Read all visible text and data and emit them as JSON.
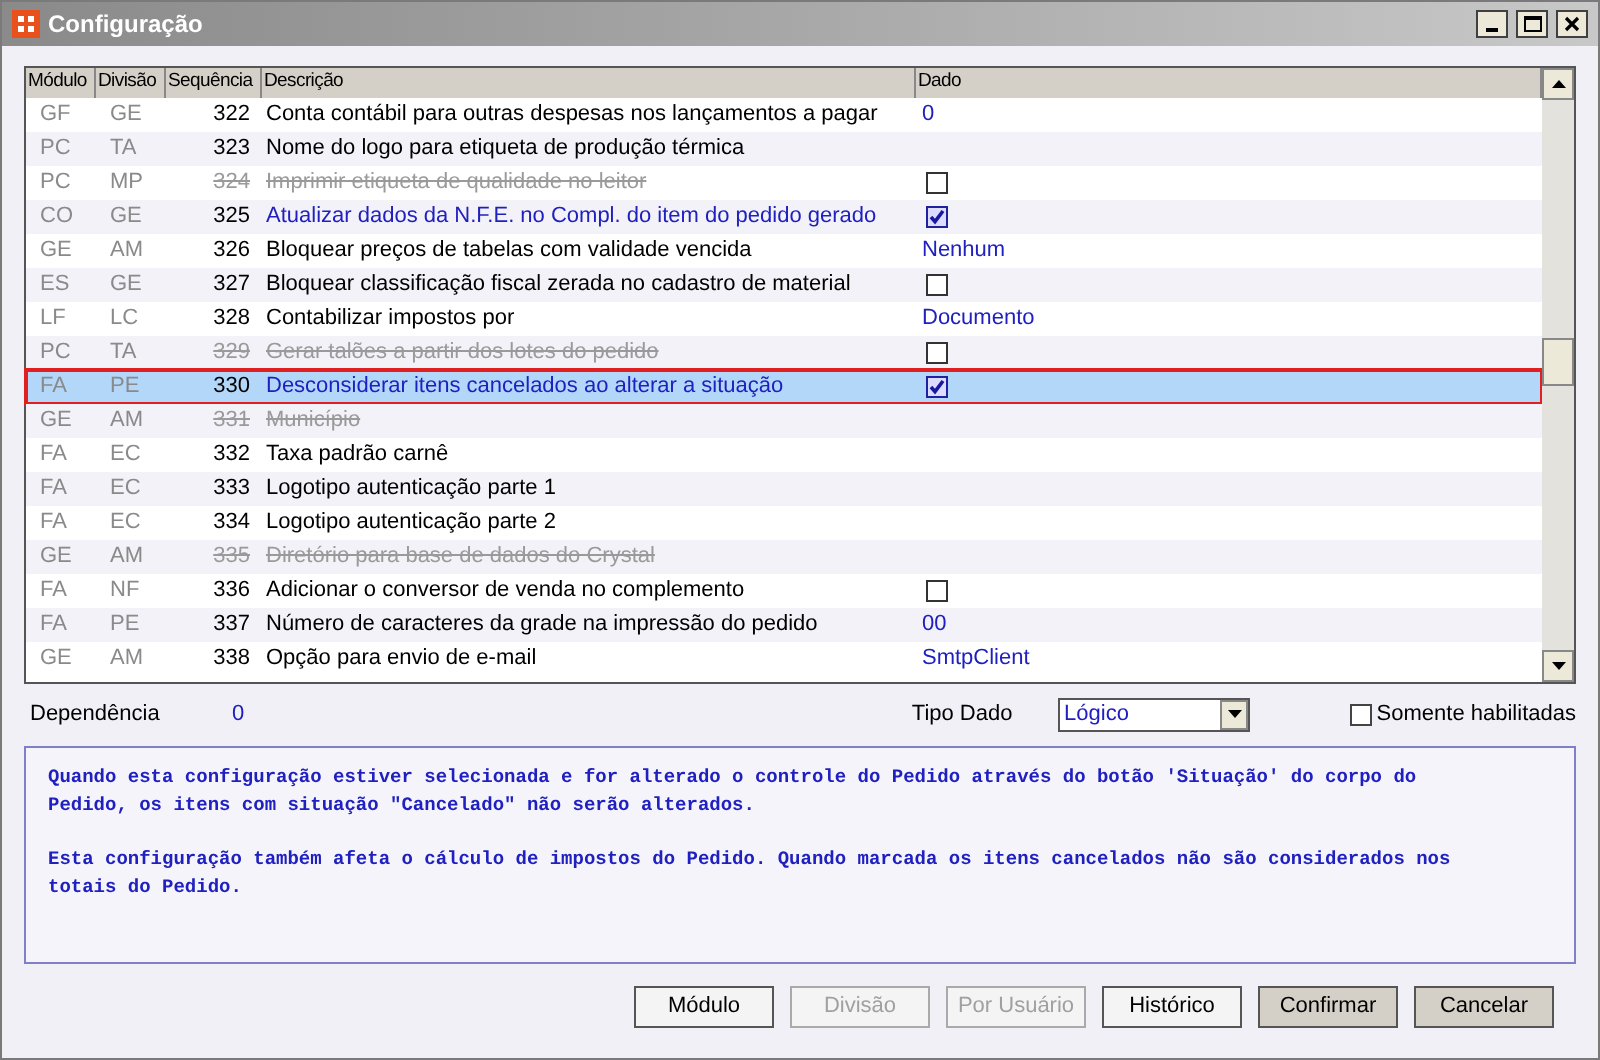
{
  "window": {
    "title": "Configuração"
  },
  "table": {
    "columns": [
      "Módulo",
      "Divisão",
      "Sequência",
      "Descrição",
      "Dado"
    ],
    "rows": [
      {
        "modulo": "GF",
        "divisao": "GE",
        "sequencia": "322",
        "descricao": "Conta contábil para outras despesas nos lançamentos a pagar",
        "disabled": false,
        "highlighted": false,
        "selected": false,
        "dado": {
          "kind": "text",
          "value": "0"
        }
      },
      {
        "modulo": "PC",
        "divisao": "TA",
        "sequencia": "323",
        "descricao": "Nome do logo para etiqueta de produção térmica",
        "disabled": false,
        "highlighted": false,
        "selected": false,
        "dado": {
          "kind": "empty"
        }
      },
      {
        "modulo": "PC",
        "divisao": "MP",
        "sequencia": "324",
        "descricao": "Imprimir etiqueta de qualidade no leitor",
        "disabled": true,
        "highlighted": false,
        "selected": false,
        "dado": {
          "kind": "checkbox",
          "checked": false
        }
      },
      {
        "modulo": "CO",
        "divisao": "GE",
        "sequencia": "325",
        "descricao": "Atualizar dados da N.F.E. no Compl. do item do pedido gerado",
        "disabled": false,
        "highlighted": true,
        "selected": false,
        "dado": {
          "kind": "checkbox",
          "checked": true
        }
      },
      {
        "modulo": "GE",
        "divisao": "AM",
        "sequencia": "326",
        "descricao": "Bloquear preços de tabelas com validade vencida",
        "disabled": false,
        "highlighted": false,
        "selected": false,
        "dado": {
          "kind": "text",
          "value": "Nenhum"
        }
      },
      {
        "modulo": "ES",
        "divisao": "GE",
        "sequencia": "327",
        "descricao": "Bloquear classificação fiscal zerada no cadastro de material",
        "disabled": false,
        "highlighted": false,
        "selected": false,
        "dado": {
          "kind": "checkbox",
          "checked": false
        }
      },
      {
        "modulo": "LF",
        "divisao": "LC",
        "sequencia": "328",
        "descricao": "Contabilizar impostos por",
        "disabled": false,
        "highlighted": false,
        "selected": false,
        "dado": {
          "kind": "text",
          "value": "Documento"
        }
      },
      {
        "modulo": "PC",
        "divisao": "TA",
        "sequencia": "329",
        "descricao": "Gerar talões a partir dos lotes do pedido",
        "disabled": true,
        "highlighted": false,
        "selected": false,
        "dado": {
          "kind": "checkbox",
          "checked": false
        }
      },
      {
        "modulo": "FA",
        "divisao": "PE",
        "sequencia": "330",
        "descricao": "Desconsiderar itens cancelados ao alterar a situação",
        "disabled": false,
        "highlighted": true,
        "selected": true,
        "dado": {
          "kind": "checkbox",
          "checked": true
        }
      },
      {
        "modulo": "GE",
        "divisao": "AM",
        "sequencia": "331",
        "descricao": "Município",
        "disabled": true,
        "highlighted": false,
        "selected": false,
        "dado": {
          "kind": "empty"
        }
      },
      {
        "modulo": "FA",
        "divisao": "EC",
        "sequencia": "332",
        "descricao": "Taxa padrão carnê",
        "disabled": false,
        "highlighted": false,
        "selected": false,
        "dado": {
          "kind": "empty"
        }
      },
      {
        "modulo": "FA",
        "divisao": "EC",
        "sequencia": "333",
        "descricao": "Logotipo autenticação parte 1",
        "disabled": false,
        "highlighted": false,
        "selected": false,
        "dado": {
          "kind": "empty"
        }
      },
      {
        "modulo": "FA",
        "divisao": "EC",
        "sequencia": "334",
        "descricao": "Logotipo autenticação parte 2",
        "disabled": false,
        "highlighted": false,
        "selected": false,
        "dado": {
          "kind": "empty"
        }
      },
      {
        "modulo": "GE",
        "divisao": "AM",
        "sequencia": "335",
        "descricao": "Diretório para base de dados do Crystal",
        "disabled": true,
        "highlighted": false,
        "selected": false,
        "dado": {
          "kind": "empty"
        }
      },
      {
        "modulo": "FA",
        "divisao": "NF",
        "sequencia": "336",
        "descricao": "Adicionar o conversor de venda no complemento",
        "disabled": false,
        "highlighted": false,
        "selected": false,
        "dado": {
          "kind": "checkbox",
          "checked": false
        }
      },
      {
        "modulo": "FA",
        "divisao": "PE",
        "sequencia": "337",
        "descricao": "Número de caracteres da grade na impressão do pedido",
        "disabled": false,
        "highlighted": false,
        "selected": false,
        "dado": {
          "kind": "text",
          "value": "00"
        }
      },
      {
        "modulo": "GE",
        "divisao": "AM",
        "sequencia": "338",
        "descricao": "Opção para envio de e-mail",
        "disabled": false,
        "highlighted": false,
        "selected": false,
        "dado": {
          "kind": "text",
          "value": "SmtpClient"
        }
      }
    ]
  },
  "dependencia": {
    "label": "Dependência",
    "value": "0"
  },
  "tipo_dado": {
    "label": "Tipo Dado",
    "value": "Lógico"
  },
  "somente_habilitadas": {
    "label": "Somente habilitadas",
    "checked": false
  },
  "help_text": [
    [
      "Quando esta configuração estiver selecionada e for alterado o controle do Pedido através do botão 'Situação' do corpo do",
      "Pedido, os itens com situação \"Cancelado\" não serão alterados."
    ],
    [
      "Esta configuração também afeta o cálculo de impostos do Pedido. Quando marcada os itens cancelados não são considerados nos",
      "totais do Pedido."
    ]
  ],
  "buttons": [
    {
      "label": "Módulo",
      "disabled": false
    },
    {
      "label": "Divisão",
      "disabled": true
    },
    {
      "label": "Por Usuário",
      "disabled": true
    },
    {
      "label": "Histórico",
      "disabled": false
    },
    {
      "label": "Confirmar",
      "disabled": false
    },
    {
      "label": "Cancelar",
      "disabled": false
    }
  ]
}
